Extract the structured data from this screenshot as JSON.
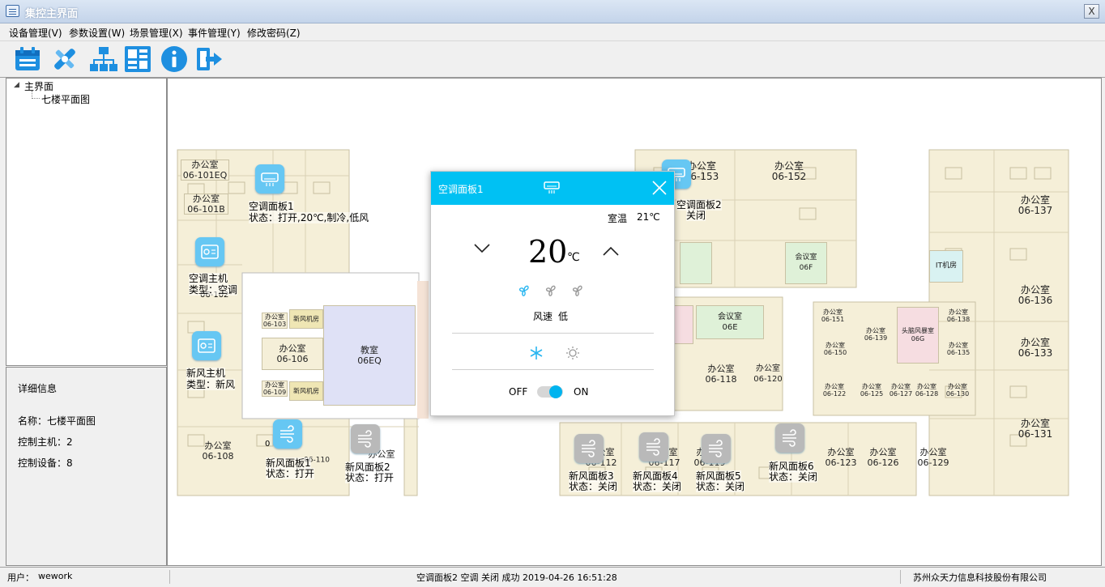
{
  "window": {
    "title": "集控主界面",
    "close_label": "X"
  },
  "menu": [
    "设备管理(V)",
    "参数设置(W)",
    "场景管理(X)",
    "事件管理(Y)",
    "修改密码(Z)"
  ],
  "toolbar": [
    "calendar-icon",
    "settings-icon",
    "hierarchy-icon",
    "layout-icon",
    "info-icon",
    "exit-icon"
  ],
  "tree": {
    "root": "主界面",
    "child": "七楼平面图"
  },
  "details": {
    "heading": "详细信息",
    "name": "名称：七楼平面图",
    "hosts": "控制主机：2",
    "devices": "控制设备：8"
  },
  "rooms": [
    {
      "l1": "办公室",
      "l2": "06-101EQ"
    },
    {
      "l1": "办公室",
      "l2": "06-101B"
    },
    {
      "l1": "办公室",
      "l2": "06-103"
    },
    {
      "l1": "新风机房",
      "l2": ""
    },
    {
      "l1": "办公室",
      "l2": "06-106"
    },
    {
      "l1": "办公室",
      "l2": "06-109"
    },
    {
      "l1": "新风机房",
      "l2": ""
    },
    {
      "l1": "教室",
      "l2": "06EQ"
    },
    {
      "l1": "办公室",
      "l2": "06-108"
    },
    {
      "l1": "办公室",
      "l2": "06-153"
    },
    {
      "l1": "办公室",
      "l2": "06-152"
    },
    {
      "l1": "会议室",
      "l2": "06F"
    },
    {
      "l1": "办公室",
      "l2": "06-137"
    },
    {
      "l1": "IT机房",
      "l2": ""
    },
    {
      "l1": "办公室",
      "l2": "06-136"
    },
    {
      "l1": "办公室",
      "l2": "06-133"
    },
    {
      "l1": "会议室",
      "l2": "06E"
    },
    {
      "l1": "办公室",
      "l2": "06-118"
    },
    {
      "l1": "办公室",
      "l2": "06-120"
    },
    {
      "l1": "办公室",
      "l2": "06-151"
    },
    {
      "l1": "办公室",
      "l2": "06-139"
    },
    {
      "l1": "头脑风暴室",
      "l2": "06G"
    },
    {
      "l1": "办公室",
      "l2": "06-138"
    },
    {
      "l1": "办公室",
      "l2": "06-150"
    },
    {
      "l1": "办公室",
      "l2": "06-135"
    },
    {
      "l1": "办公室",
      "l2": "06-122"
    },
    {
      "l1": "办公室",
      "l2": "06-125"
    },
    {
      "l1": "办公室",
      "l2": "06-127"
    },
    {
      "l1": "办公室",
      "l2": "06-128"
    },
    {
      "l1": "办公室",
      "l2": "06-130"
    },
    {
      "l1": "办公室",
      "l2": "06-131"
    },
    {
      "l1": "办公室",
      "l2": "06-112"
    },
    {
      "l1": "办公室",
      "l2": "06-117"
    },
    {
      "l1": "办公室",
      "l2": "06-119"
    },
    {
      "l1": "办公室",
      "l2": "06-123"
    },
    {
      "l1": "办公室",
      "l2": "06-126"
    },
    {
      "l1": "办公室",
      "l2": "06-129"
    },
    {
      "l1": "办公室",
      "l2": ""
    },
    {
      "l1": "",
      "l2": "06-110"
    }
  ],
  "devices": [
    {
      "l1": "空调面板1",
      "l2": "状态：打开,20℃,制冷,低风",
      "state": "on",
      "kind": "ac"
    },
    {
      "l1": "空调主机",
      "l2": "类型：空调",
      "state": "on",
      "kind": "host"
    },
    {
      "l1": "新风主机",
      "l2": "类型：新风",
      "state": "on",
      "kind": "host"
    },
    {
      "l1": "新风面板1",
      "l2": "状态：打开",
      "state": "on",
      "kind": "fresh"
    },
    {
      "l1": "新风面板2",
      "l2": "状态：打开",
      "state": "off",
      "kind": "fresh"
    },
    {
      "l1": "空调面板2",
      "l2": "关闭",
      "state": "on",
      "kind": "ac"
    },
    {
      "l1": "新风面板3",
      "l2": "状态：关闭",
      "state": "off",
      "kind": "fresh"
    },
    {
      "l1": "新风面板4",
      "l2": "状态：关闭",
      "state": "off",
      "kind": "fresh"
    },
    {
      "l1": "新风面板5",
      "l2": "状态：关闭",
      "state": "off",
      "kind": "fresh"
    },
    {
      "l1": "新风面板6",
      "l2": "状态：关闭",
      "state": "off",
      "kind": "fresh"
    }
  ],
  "room_ids": [
    "06-102",
    "0"
  ],
  "dialog": {
    "title": "空调面板1",
    "room_temp_label": "室温",
    "room_temp": "21℃",
    "set_temp": "20",
    "unit": "℃",
    "fan_label": "风速",
    "fan_value": "低",
    "off_label": "OFF",
    "on_label": "ON",
    "accent": "#00c1f3",
    "power_on": true
  },
  "status": {
    "user_label": "用户：",
    "user": "wework",
    "message": "空调面板2  空调  关闭  成功  2019-04-26 16:51:28",
    "company": "苏州众天力信息科技股份有限公司"
  }
}
